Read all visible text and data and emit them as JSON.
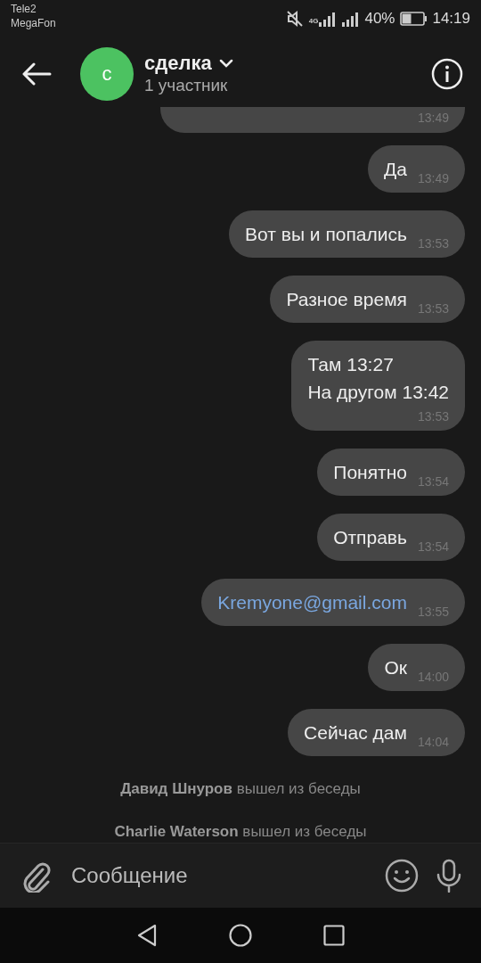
{
  "status_bar": {
    "carriers": [
      "Tele2",
      "MegaFon"
    ],
    "network": "4G",
    "battery_text": "40%",
    "time": "14:19"
  },
  "header": {
    "avatar_letter": "с",
    "title": "сделка",
    "subtitle": "1 участник"
  },
  "messages": [
    {
      "kind": "cut",
      "time": "13:49"
    },
    {
      "kind": "text",
      "lines": [
        "Да"
      ],
      "time": "13:49"
    },
    {
      "kind": "text",
      "lines": [
        "Вот вы и попались"
      ],
      "time": "13:53"
    },
    {
      "kind": "text",
      "lines": [
        "Разное время"
      ],
      "time": "13:53"
    },
    {
      "kind": "text",
      "lines": [
        "Там 13:27",
        "На другом 13:42"
      ],
      "time": "13:53"
    },
    {
      "kind": "text",
      "lines": [
        "Понятно"
      ],
      "time": "13:54"
    },
    {
      "kind": "text",
      "lines": [
        "Отправь"
      ],
      "time": "13:54"
    },
    {
      "kind": "link",
      "lines": [
        "Kremyone@gmail.com"
      ],
      "time": "13:55"
    },
    {
      "kind": "text",
      "lines": [
        "Ок"
      ],
      "time": "14:00"
    },
    {
      "kind": "text",
      "lines": [
        "Сейчас дам"
      ],
      "time": "14:04"
    }
  ],
  "events": [
    "**Давид Шнуров** вышел из беседы",
    "**Charlie Waterson** вышел из беседы"
  ],
  "composer": {
    "placeholder": "Сообщение"
  }
}
